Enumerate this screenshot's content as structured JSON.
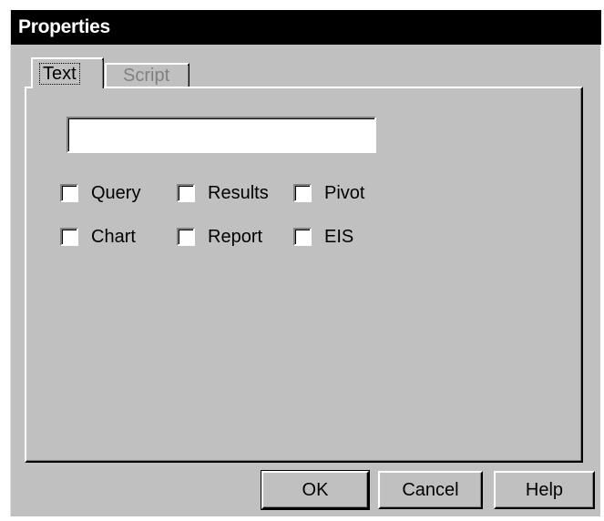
{
  "window": {
    "title": "Properties"
  },
  "tabs": [
    {
      "label": "Text",
      "selected": true
    },
    {
      "label": "Script",
      "selected": false
    }
  ],
  "text_field": {
    "value": "",
    "placeholder": ""
  },
  "checkboxes": [
    {
      "label": "Query",
      "checked": false
    },
    {
      "label": "Results",
      "checked": false
    },
    {
      "label": "Pivot",
      "checked": false
    },
    {
      "label": "Chart",
      "checked": false
    },
    {
      "label": "Report",
      "checked": false
    },
    {
      "label": "EIS",
      "checked": false
    }
  ],
  "buttons": {
    "ok": "OK",
    "cancel": "Cancel",
    "help": "Help"
  },
  "colors": {
    "face": "#c0c0c0",
    "titlebar": "#000000",
    "title_text": "#ffffff"
  }
}
